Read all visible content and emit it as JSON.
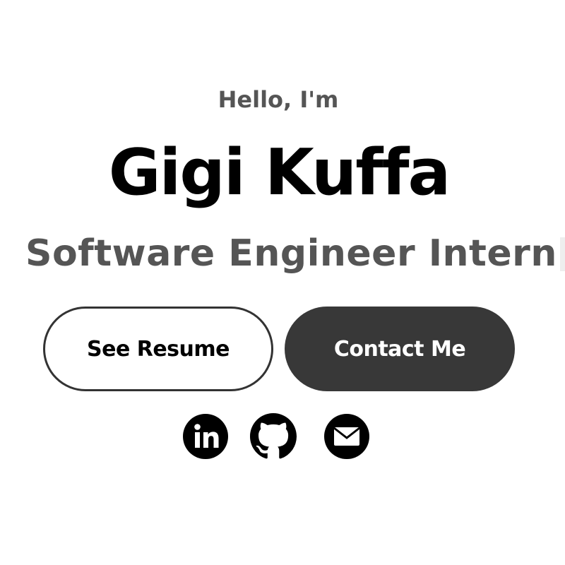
{
  "hero": {
    "greeting": "Hello, I'm",
    "name": "Gigi Kuffa",
    "role": "Software Engineer Intern"
  },
  "buttons": {
    "resume_label": "See Resume",
    "contact_label": "Contact Me"
  },
  "social": [
    {
      "icon": "linkedin-icon",
      "color": "#000000"
    },
    {
      "icon": "github-icon",
      "color": "#000000"
    },
    {
      "icon": "email-icon",
      "color": "#000000"
    }
  ],
  "colors": {
    "primary_text": "#000000",
    "secondary_text": "#555555",
    "button_dark": "#383838",
    "button_border": "#333333"
  }
}
